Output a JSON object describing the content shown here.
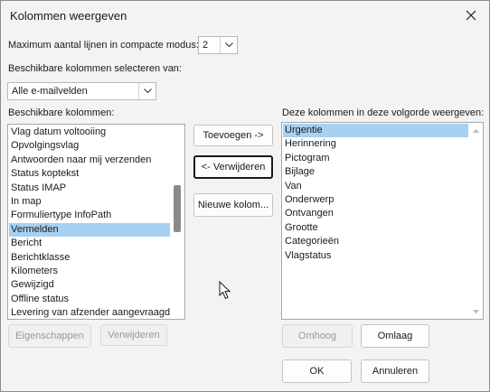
{
  "window": {
    "title": "Kolommen weergeven"
  },
  "max_lines": {
    "label": "Maximum aantal lijnen in compacte modus:",
    "value": "2"
  },
  "select_from": {
    "label": "Beschikbare kolommen selecteren van:",
    "value": "Alle e-mailvelden"
  },
  "available": {
    "label": "Beschikbare kolommen:",
    "items": [
      "Vlag datum voltooiing",
      "Opvolgingsvlag",
      "Antwoorden naar mij verzenden",
      "Status koptekst",
      "Status IMAP",
      "In map",
      "Formuliertype InfoPath",
      "Vermelden",
      "Bericht",
      "Berichtklasse",
      "Kilometers",
      "Gewijzigd",
      "Offline status",
      "Levering van afzender aangevraagd"
    ],
    "selected_index": 7
  },
  "shown": {
    "label": "Deze kolommen in deze volgorde weergeven:",
    "items": [
      "Urgentie",
      "Herinnering",
      "Pictogram",
      "Bijlage",
      "Van",
      "Onderwerp",
      "Ontvangen",
      "Grootte",
      "Categorieën",
      "Vlagstatus"
    ],
    "selected_index": 0
  },
  "buttons": {
    "add": "Toevoegen ->",
    "remove": "<- Verwijderen",
    "new_column": "Nieuwe kolom...",
    "properties": "Eigenschappen",
    "delete": "Verwijderen",
    "move_up": "Omhoog",
    "move_down": "Omlaag",
    "ok": "OK",
    "cancel": "Annuleren"
  }
}
